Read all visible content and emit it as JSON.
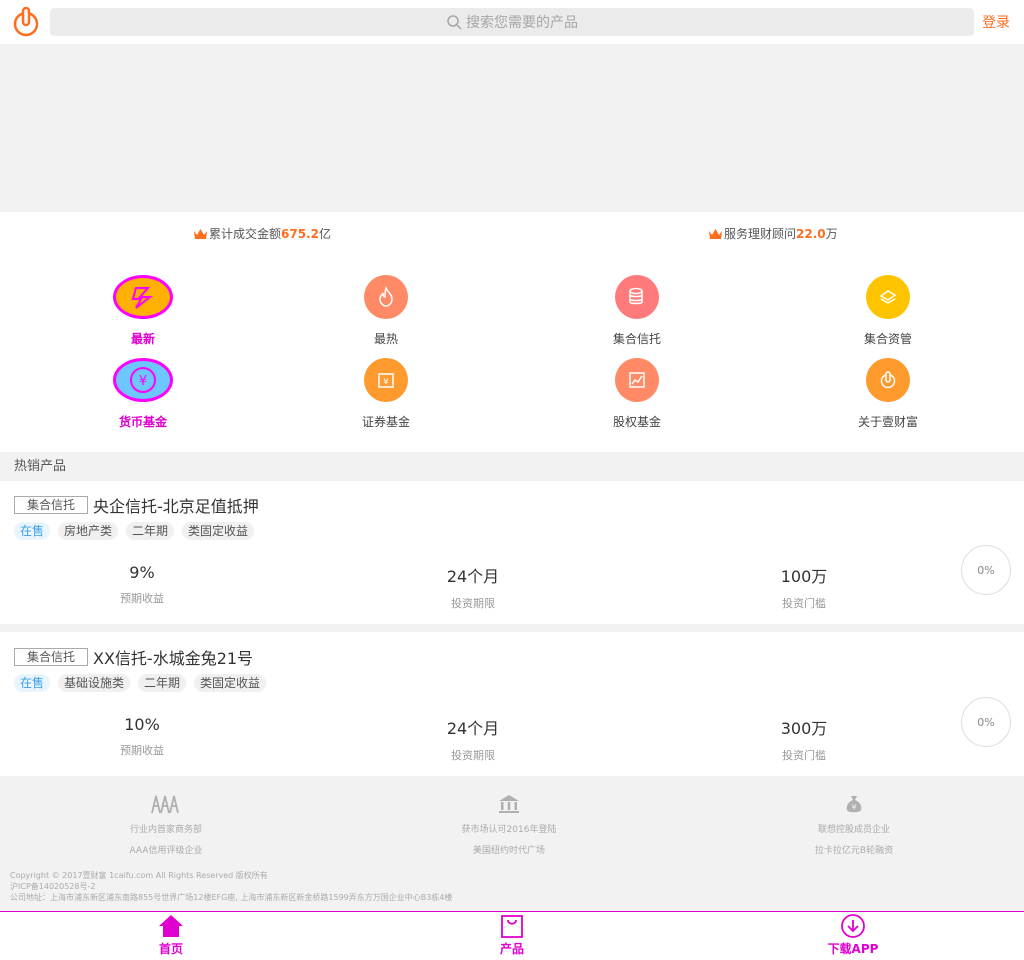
{
  "header": {
    "search_placeholder": "搜索您需要的产品",
    "login_label": "登录"
  },
  "stats": {
    "left_prefix": "累计成交金额",
    "left_value": "675.2",
    "left_unit": "亿",
    "right_prefix": "服务理财顾问",
    "right_value": "22.0",
    "right_unit": "万"
  },
  "categories": [
    {
      "label": "最新",
      "icon": "flash-icon"
    },
    {
      "label": "最热",
      "icon": "flame-icon"
    },
    {
      "label": "集合信托",
      "icon": "database-icon"
    },
    {
      "label": "集合资管",
      "icon": "coins-icon"
    },
    {
      "label": "货币基金",
      "icon": "currency-icon"
    },
    {
      "label": "证券基金",
      "icon": "yen-box-icon"
    },
    {
      "label": "股权基金",
      "icon": "chart-icon"
    },
    {
      "label": "关于壹财富",
      "icon": "power-icon"
    }
  ],
  "section": {
    "hot_title": "热销产品"
  },
  "products": [
    {
      "type": "集合信托",
      "name": "央企信托-北京足值抵押",
      "tags": [
        "在售",
        "房地产类",
        "二年期",
        "类固定收益"
      ],
      "yield": "9%",
      "yield_label": "预期收益",
      "term": "24个月",
      "term_label": "投资期限",
      "min": "100万",
      "min_label": "投资门槛",
      "progress": "0%"
    },
    {
      "type": "集合信托",
      "name": "XX信托-水城金兔21号",
      "tags": [
        "在售",
        "基础设施类",
        "二年期",
        "类固定收益"
      ],
      "yield": "10%",
      "yield_label": "预期收益",
      "term": "24个月",
      "term_label": "投资期限",
      "min": "300万",
      "min_label": "投资门槛",
      "progress": "0%"
    }
  ],
  "footer": {
    "col1": [
      "行业内首家商务部",
      "AAA信用评级企业"
    ],
    "col2": [
      "获市场认可2016年登陆",
      "美国纽约时代广场"
    ],
    "col3": [
      "联想控股成员企业",
      "拉卡拉亿元B轮融资"
    ],
    "copyright": "Copyright © 2017壹财富 1caifu.com All Rights Reserved 版权所有",
    "icp": "沪ICP备14020528号-2",
    "address": "公司地址：上海市浦东新区浦东南路855号世界广场12楼EFG座, 上海市浦东新区新金桥路1599弄东方万国企业中心B3栋4楼"
  },
  "tabbar": {
    "home": "首页",
    "products": "产品",
    "download": "下载APP"
  },
  "colors": {
    "accent": "#ff6d1f",
    "magenta": "#e000d0"
  }
}
